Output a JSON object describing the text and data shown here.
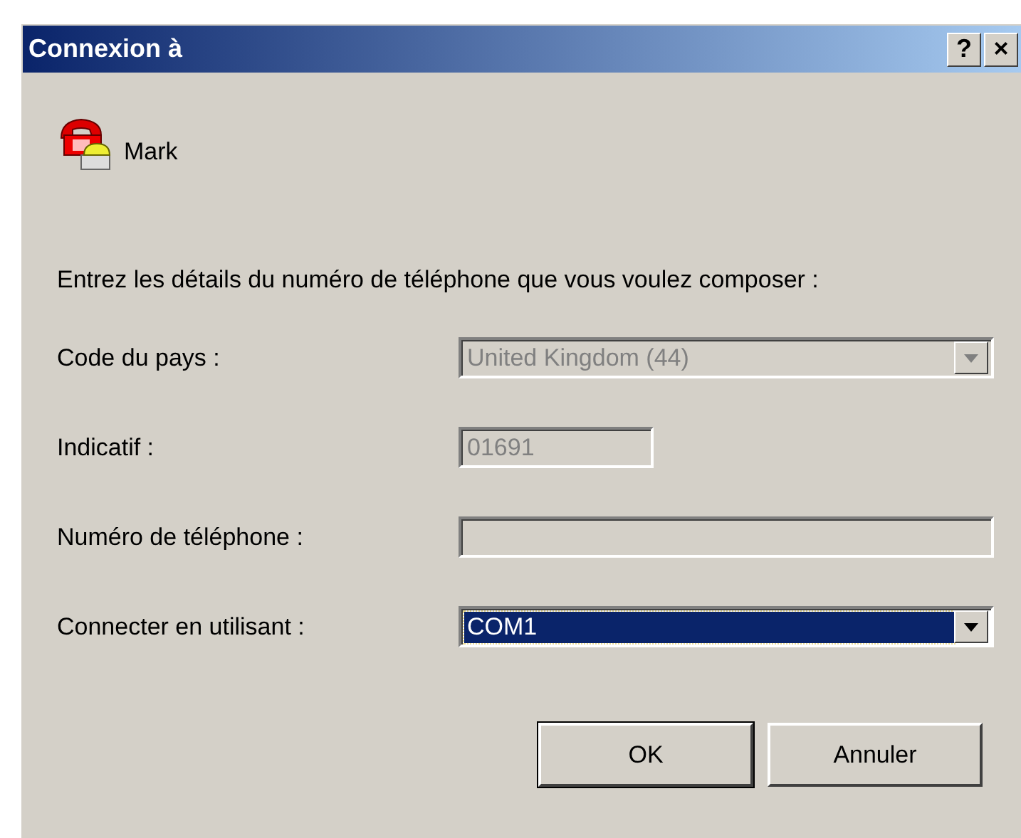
{
  "window": {
    "title": "Connexion à",
    "title_buttons": [
      "?",
      "×"
    ]
  },
  "connection_name": "Mark",
  "instruction": "Entrez les détails du numéro de téléphone que vous voulez composer :",
  "fields": [
    {
      "label": "Code du pays :",
      "kind": "combo",
      "value": "United Kingdom (44)",
      "disabled": true,
      "selected": false
    },
    {
      "label": "Indicatif :",
      "kind": "code",
      "value": "01691",
      "disabled": true,
      "selected": false
    },
    {
      "label": "Numéro de téléphone :",
      "kind": "text",
      "disabled": true,
      "selected": false
    },
    {
      "label": "Connecter en utilisant :",
      "kind": "combo",
      "value": "COM1",
      "disabled": false,
      "selected": true
    }
  ],
  "buttons": [
    {
      "label": "OK",
      "default": true
    },
    {
      "label": "Annuler",
      "default": false
    }
  ]
}
